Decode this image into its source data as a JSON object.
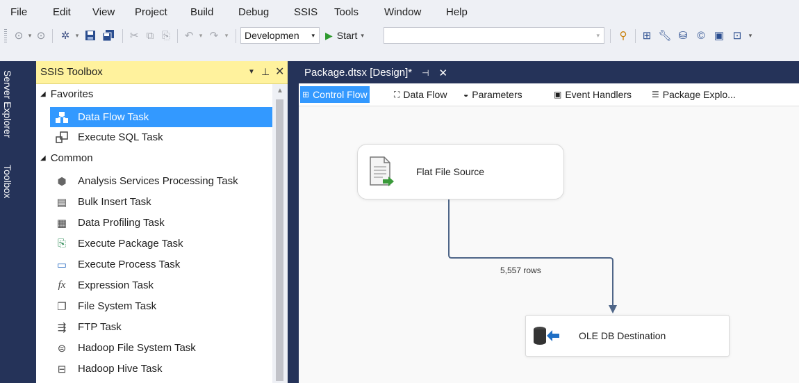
{
  "menu": [
    "File",
    "Edit",
    "View",
    "Project",
    "Build",
    "Debug",
    "SSIS",
    "Tools",
    "Window",
    "Help"
  ],
  "toolbar": {
    "config_value": "Developmen",
    "start_label": "Start"
  },
  "side_tabs": [
    "Server Explorer",
    "Toolbox"
  ],
  "toolbox": {
    "title": "SSIS Toolbox",
    "favorites_label": "Favorites",
    "favorites": [
      "Data Flow Task",
      "Execute SQL Task"
    ],
    "common_label": "Common",
    "common": [
      "Analysis Services Processing Task",
      "Bulk Insert Task",
      "Data Profiling Task",
      "Execute Package Task",
      "Execute Process Task",
      "Expression Task",
      "File System Task",
      "FTP Task",
      "Hadoop File System Task",
      "Hadoop Hive Task"
    ]
  },
  "document_tab": "Package.dtsx [Design]*",
  "designer_tabs": [
    "Control Flow",
    "Data Flow",
    "Parameters",
    "Event Handlers",
    "Package Explo..."
  ],
  "diagram": {
    "source": "Flat File Source",
    "path_label": "5,557 rows",
    "destination": "OLE DB Destination"
  },
  "colors": {
    "selection": "#3399ff",
    "dark_frame": "#253359",
    "toolbox_header": "#fff29d",
    "start_green": "#2e9a2e"
  }
}
